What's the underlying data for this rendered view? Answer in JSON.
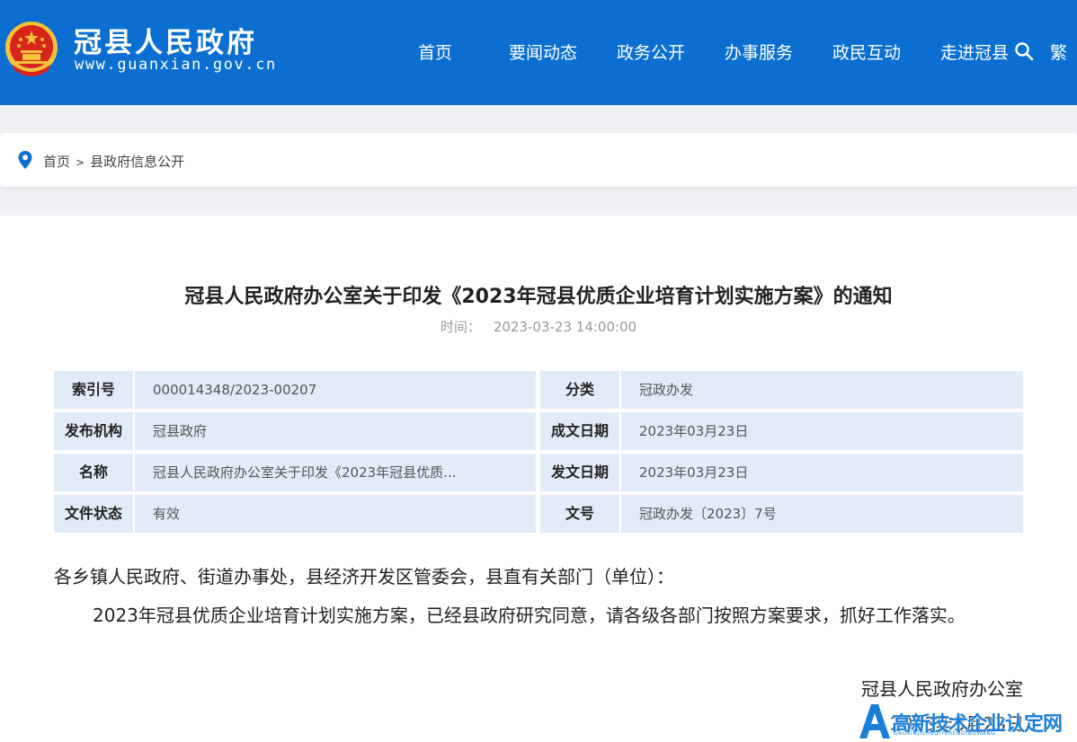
{
  "header": {
    "site_title": "冠县人民政府",
    "site_domain": "www.guanxian.gov.cn",
    "nav": [
      "首页",
      "要闻动态",
      "政务公开",
      "办事服务",
      "政民互动",
      "走进冠县"
    ],
    "lang_toggle": "繁"
  },
  "breadcrumb": {
    "home": "首页",
    "separator": ">",
    "current": "县政府信息公开"
  },
  "article": {
    "title": "冠县人民政府办公室关于印发《2023年冠县优质企业培育计划实施方案》的通知",
    "time_label": "时间：",
    "time_value": "2023-03-23 14:00:00",
    "meta": [
      {
        "label": "索引号",
        "value": "000014348/2023-00207",
        "label2": "分类",
        "value2": "冠政办发"
      },
      {
        "label": "发布机构",
        "value": "冠县政府",
        "label2": "成文日期",
        "value2": "2023年03月23日"
      },
      {
        "label": "名称",
        "value": "冠县人民政府办公室关于印发《2023年冠县优质...",
        "label2": "发文日期",
        "value2": "2023年03月23日"
      },
      {
        "label": "文件状态",
        "value": "有效",
        "label2": "文号",
        "value2": "冠政办发〔2023〕7号"
      }
    ],
    "paragraph1": "各乡镇人民政府、街道办事处，县经济开发区管委会，县直有关部门（单位）：",
    "paragraph2": "2023年冠县优质企业培育计划实施方案，已经县政府研究同意，请各级各部门按照方案要求，抓好工作落实。",
    "signature": "冠县人民政府办公室",
    "sign_date": "2023年3月23日"
  },
  "watermark": {
    "text": "高新技术企业认定网",
    "sub": "GAOXINJISHUQIYERENDINGWANG"
  },
  "colors": {
    "header_bg": "#0a6fd1",
    "meta_cell_bg": "#e1ecf8",
    "emblem_red": "#d9241c",
    "emblem_gold": "#f3c33a"
  }
}
